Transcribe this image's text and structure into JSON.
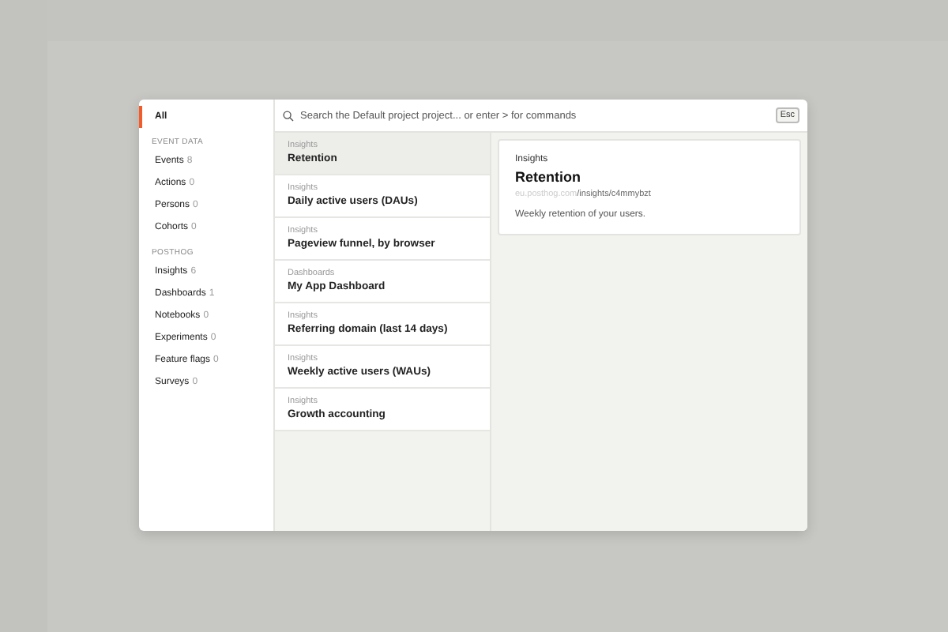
{
  "sidebar": {
    "items": [
      {
        "label": "All",
        "selected": true
      }
    ],
    "sections": [
      {
        "heading": "EVENT DATA",
        "items": [
          {
            "label": "Events",
            "count": "8",
            "selected": false
          },
          {
            "label": "Actions",
            "count": "0",
            "selected": false
          },
          {
            "label": "Persons",
            "count": "0",
            "selected": false
          },
          {
            "label": "Cohorts",
            "count": "0",
            "selected": false
          }
        ]
      },
      {
        "heading": "POSTHOG",
        "items": [
          {
            "label": "Insights",
            "count": "6",
            "selected": false
          },
          {
            "label": "Dashboards",
            "count": "1",
            "selected": false
          },
          {
            "label": "Notebooks",
            "count": "0",
            "selected": false
          },
          {
            "label": "Experiments",
            "count": "0",
            "selected": false
          },
          {
            "label": "Feature flags",
            "count": "0",
            "selected": false
          },
          {
            "label": "Surveys",
            "count": "0",
            "selected": false
          }
        ]
      }
    ]
  },
  "search": {
    "placeholder": "Search the Default project project... or enter > for commands",
    "shortcut": "Esc"
  },
  "results": [
    {
      "category": "Insights",
      "title": "Retention",
      "selected": true
    },
    {
      "category": "Insights",
      "title": "Daily active users (DAUs)",
      "selected": false
    },
    {
      "category": "Insights",
      "title": "Pageview funnel, by browser",
      "selected": false
    },
    {
      "category": "Dashboards",
      "title": "My App Dashboard",
      "selected": false
    },
    {
      "category": "Insights",
      "title": "Referring domain (last 14 days)",
      "selected": false
    },
    {
      "category": "Insights",
      "title": "Weekly active users (WAUs)",
      "selected": false
    },
    {
      "category": "Insights",
      "title": "Growth accounting",
      "selected": false
    }
  ],
  "preview": {
    "category": "Insights",
    "title": "Retention",
    "url_host": "eu.posthog.com",
    "url_path": "/insights/c4mmybzt",
    "description": "Weekly retention of your users."
  }
}
